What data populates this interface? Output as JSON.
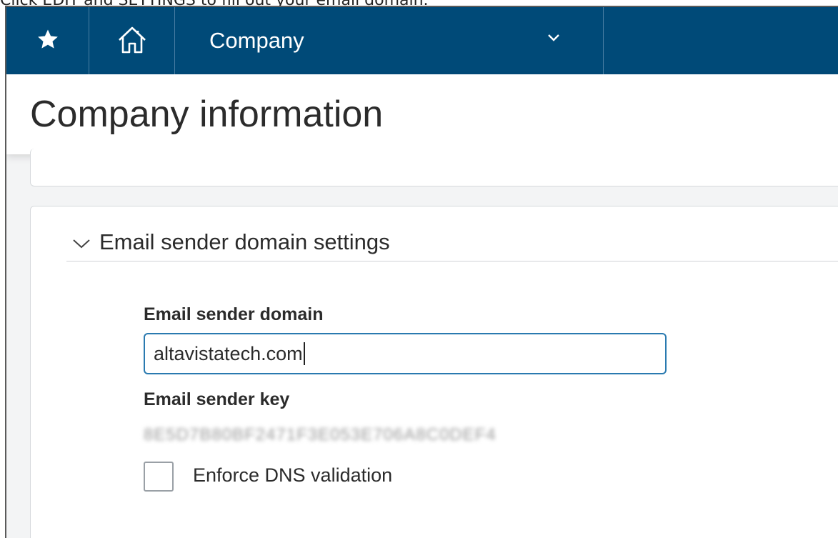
{
  "caption": "Click EDIT and SETTINGS to fill out your email domain.",
  "topbar": {
    "company_label": "Company",
    "icons": [
      "star-icon",
      "home-icon",
      "chevron-down-icon"
    ]
  },
  "header": {
    "title": "Company information"
  },
  "section": {
    "title": "Email sender domain settings",
    "domain_label": "Email sender domain",
    "domain_value": "altavistatech.com",
    "key_label": "Email sender key",
    "key_value": "8E5D7B80BF2471F3E053E706A8C0DEF4",
    "dns_label": "Enforce DNS validation",
    "dns_checked": false
  },
  "colors": {
    "topbar": "#004a78",
    "input_border": "#2a7ab0",
    "background": "#f3f4f5"
  }
}
